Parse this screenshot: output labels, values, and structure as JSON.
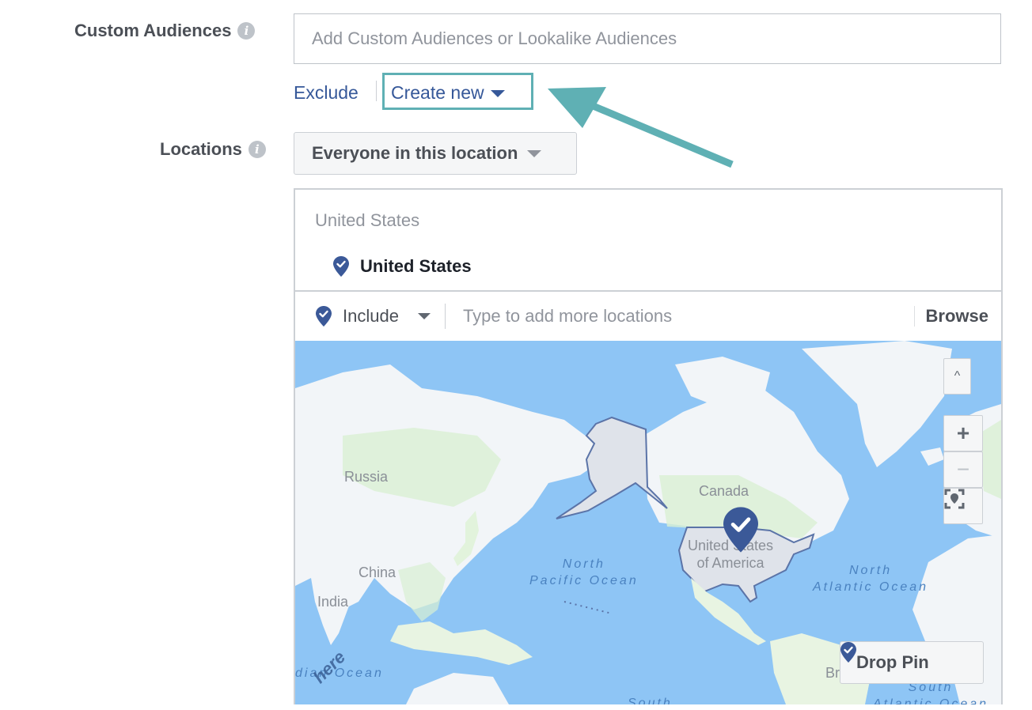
{
  "custom_audiences": {
    "label": "Custom Audiences",
    "info_icon": "info-icon",
    "placeholder": "Add Custom Audiences or Lookalike Audiences",
    "exclude_label": "Exclude",
    "create_new_label": "Create new"
  },
  "annotation": {
    "highlight_color": "#5fb0b4",
    "arrow_target": "Create new"
  },
  "locations": {
    "label": "Locations",
    "info_icon": "info-icon",
    "audience_type_selected": "Everyone in this location",
    "country_group_heading": "United States",
    "selected_locations": [
      "United States"
    ],
    "include_mode": "Include",
    "add_placeholder": "Type to add more locations",
    "browse_label": "Browse"
  },
  "map": {
    "labels": {
      "russia": "Russia",
      "china": "China",
      "india": "India",
      "canada": "Canada",
      "usa_line1": "United States",
      "usa_line2": "of America",
      "brazil": "Bra",
      "north_pacific_1": "North",
      "north_pacific_2": "Pacific Ocean",
      "north_atlantic_1": "North",
      "north_atlantic_2": "Atlantic Ocean",
      "indian_ocean": "dian Ocean",
      "south_pacific": "South",
      "south_atlantic_1": "South",
      "south_atlantic_2": "Atlantic Ocean"
    },
    "attribution": "here",
    "controls": {
      "collapse": "^",
      "zoom_in": "+",
      "zoom_out": "−"
    },
    "drop_pin_label": "Drop Pin",
    "colors": {
      "ocean": "#8ec5f5",
      "land": "#f2f5f8",
      "vegetation": "#d9f0d3",
      "selected_region": "#dfe3ea",
      "selected_border": "#5b74a8",
      "pin": "#3b5998"
    }
  }
}
